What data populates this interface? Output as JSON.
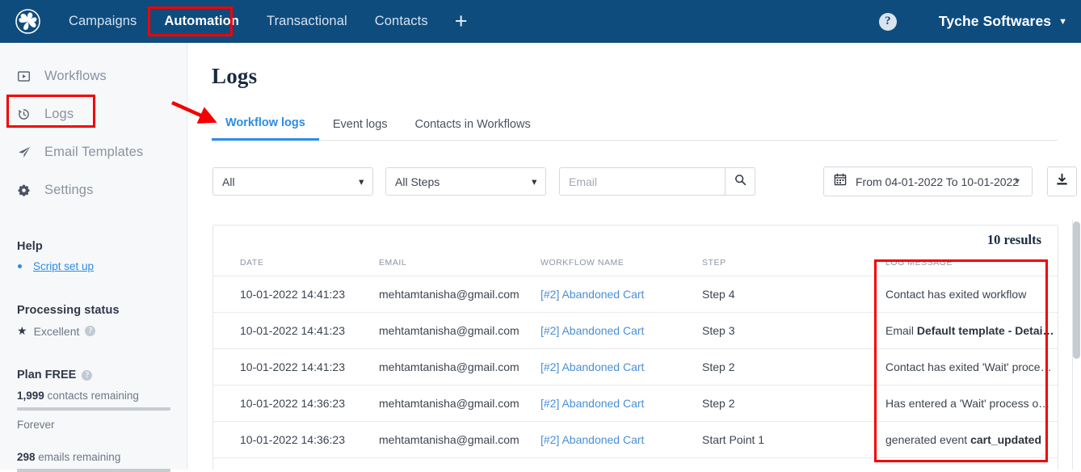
{
  "topnav": {
    "logo_icon": "pinwheel-logo-icon",
    "links": [
      {
        "label": "Campaigns",
        "active": false
      },
      {
        "label": "Automation",
        "active": true
      },
      {
        "label": "Transactional",
        "active": false
      },
      {
        "label": "Contacts",
        "active": false
      }
    ],
    "add_icon": "plus-icon",
    "help_icon": "question-mark-icon",
    "help_glyph": "?",
    "account_name": "Tyche Softwares",
    "account_caret": "▼"
  },
  "sidebar": {
    "items": [
      {
        "label": "Workflows",
        "icon": "play-box-icon"
      },
      {
        "label": "Logs",
        "icon": "history-clock-icon"
      },
      {
        "label": "Email Templates",
        "icon": "paper-plane-icon"
      },
      {
        "label": "Settings",
        "icon": "gear-icon"
      }
    ],
    "help_heading": "Help",
    "help_link": "Script set up",
    "processing_heading": "Processing status",
    "processing_value": "Excellent",
    "processing_star": "★",
    "plan_heading": "Plan FREE",
    "contacts_count": "1,999",
    "contacts_label": " contacts remaining",
    "plan_duration": "Forever",
    "emails_count": "298",
    "emails_label": " emails remaining",
    "info_glyph": "?"
  },
  "main": {
    "page_title": "Logs",
    "tabs": [
      {
        "label": "Workflow logs",
        "active": true
      },
      {
        "label": "Event logs",
        "active": false
      },
      {
        "label": "Contacts in Workflows",
        "active": false
      }
    ],
    "filters": {
      "workflow_select_value": "All",
      "step_select_value": "All Steps",
      "email_placeholder": "Email",
      "email_value": "",
      "search_icon": "search-icon",
      "calendar_icon": "calendar-icon",
      "date_range": "From 04-01-2022 To 10-01-2022",
      "date_caret": "▼",
      "export_icon": "download-icon"
    },
    "table": {
      "results_text": "10 results",
      "columns": [
        "DATE",
        "EMAIL",
        "WORKFLOW NAME",
        "STEP",
        "LOG MESSAGE"
      ],
      "rows": [
        {
          "date": "10-01-2022 14:41:23",
          "email": "mehtamtanisha@gmail.com",
          "workflow": "[#2] Abandoned Cart",
          "step": "Step 4",
          "message_prefix": "Contact has exited workflow",
          "message_bold": "",
          "message_suffix": ""
        },
        {
          "date": "10-01-2022 14:41:23",
          "email": "mehtamtanisha@gmail.com",
          "workflow": "[#2] Abandoned Cart",
          "step": "Step 3",
          "message_prefix": "Email ",
          "message_bold": "Default template - Detai…",
          "message_suffix": ""
        },
        {
          "date": "10-01-2022 14:41:23",
          "email": "mehtamtanisha@gmail.com",
          "workflow": "[#2] Abandoned Cart",
          "step": "Step 2",
          "message_prefix": "Contact has exited 'Wait' proce…",
          "message_bold": "",
          "message_suffix": ""
        },
        {
          "date": "10-01-2022 14:36:23",
          "email": "mehtamtanisha@gmail.com",
          "workflow": "[#2] Abandoned Cart",
          "step": "Step 2",
          "message_prefix": "Has entered a 'Wait' process o…",
          "message_bold": "",
          "message_suffix": ""
        },
        {
          "date": "10-01-2022 14:36:23",
          "email": "mehtamtanisha@gmail.com",
          "workflow": "[#2] Abandoned Cart",
          "step": "Start Point 1",
          "message_prefix": "generated event ",
          "message_bold": "cart_updated",
          "message_suffix": ""
        }
      ]
    }
  },
  "annotations": {
    "highlight_color": "#f50000",
    "boxes": [
      "automation-nav-tab",
      "logs-sidebar-item",
      "log-message-column"
    ],
    "arrow": "points-to-workflow-logs-tab"
  },
  "colors": {
    "header_bg": "#0f4c7e",
    "accent_blue": "#2b8ce6",
    "link_blue": "#4a8fd6",
    "sidebar_bg": "#f7f8fa",
    "annotation_red": "#f50000"
  }
}
